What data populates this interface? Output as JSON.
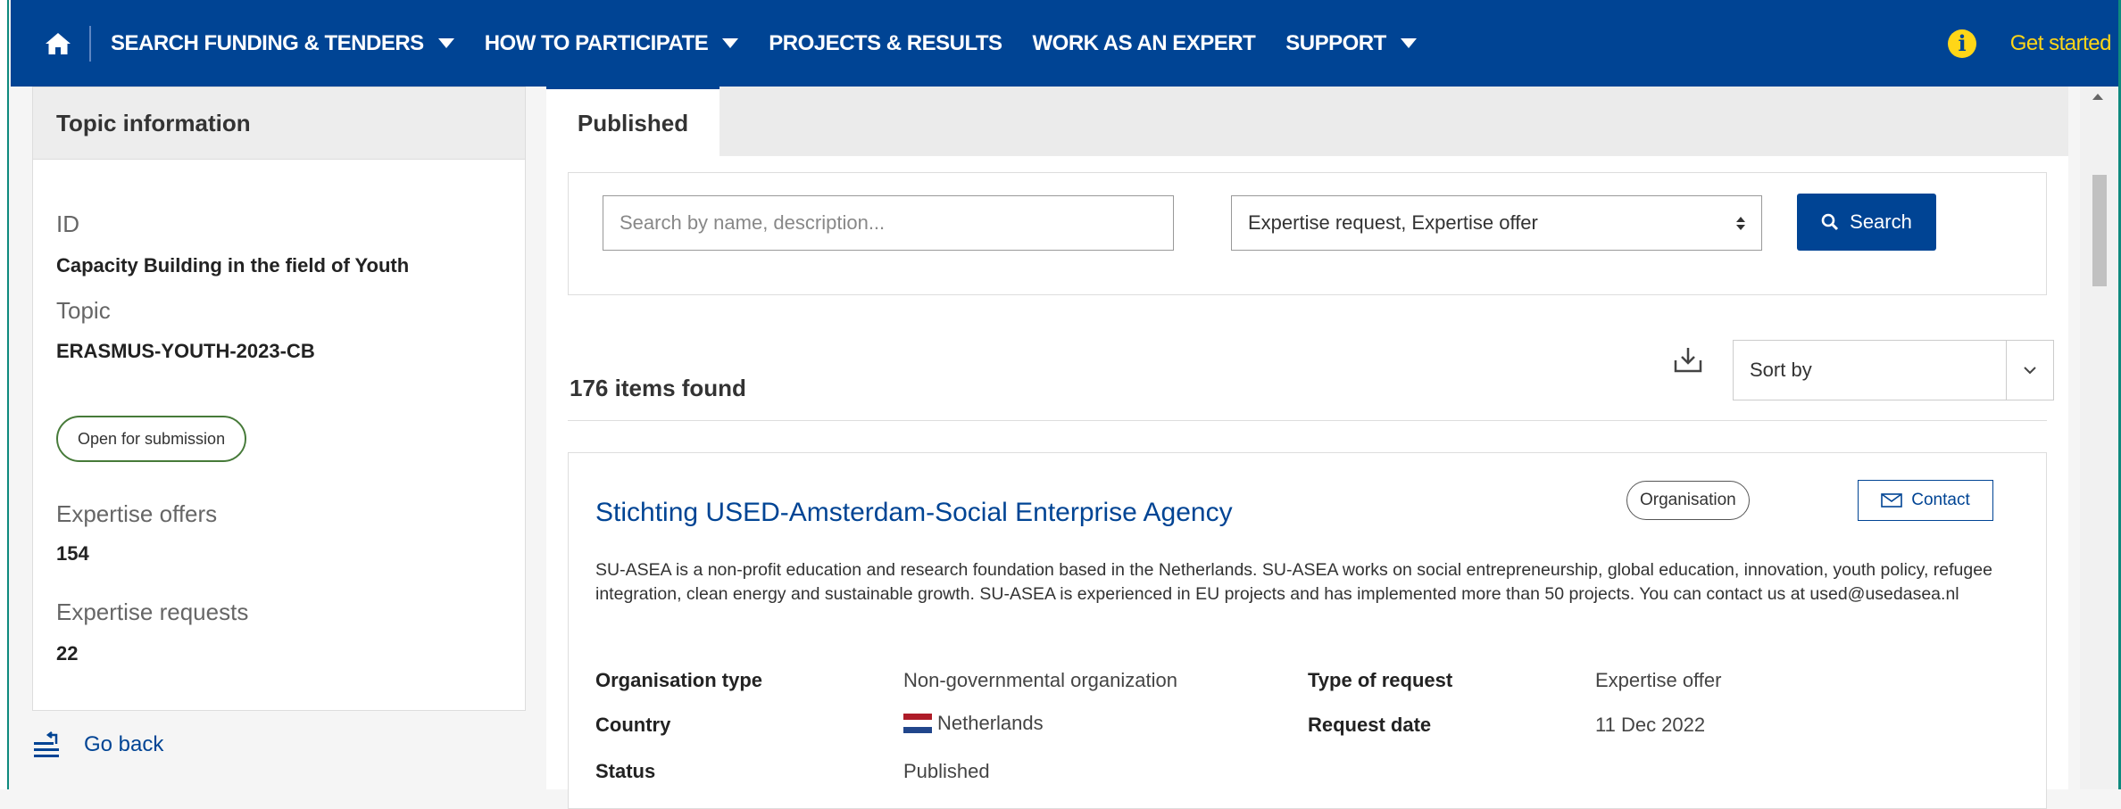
{
  "nav": {
    "items": [
      {
        "label": "SEARCH FUNDING & TENDERS",
        "dropdown": true
      },
      {
        "label": "HOW TO PARTICIPATE",
        "dropdown": true
      },
      {
        "label": "PROJECTS & RESULTS",
        "dropdown": false
      },
      {
        "label": "WORK AS AN EXPERT",
        "dropdown": false
      },
      {
        "label": "SUPPORT",
        "dropdown": true
      }
    ],
    "get_started": "Get started",
    "icons": {
      "home": "home-icon",
      "info": "info-icon"
    }
  },
  "sidebar": {
    "header": "Topic information",
    "id_label": "ID",
    "id_value": "Capacity Building in the field of Youth",
    "topic_label": "Topic",
    "topic_value": "ERASMUS-YOUTH-2023-CB",
    "status_pill": "Open for submission",
    "offers_label": "Expertise offers",
    "offers_value": "154",
    "requests_label": "Expertise requests",
    "requests_value": "22",
    "go_back": "Go back"
  },
  "tabs": [
    {
      "label": "Published",
      "active": true
    }
  ],
  "search": {
    "placeholder": "Search by name, description...",
    "filter_value": "Expertise request, Expertise offer",
    "button": "Search"
  },
  "results": {
    "count_text": "176 items found",
    "sort_label": "Sort by",
    "items": [
      {
        "title": "Stichting USED-Amsterdam-Social Enterprise Agency",
        "badge": "Organisation",
        "contact": "Contact",
        "description": "SU-ASEA is a non-profit education and research foundation based in the Netherlands. SU-ASEA works on social entrepreneurship, global education, innovation, youth policy, refugee integration, clean energy and sustainable growth. SU-ASEA is experienced in EU projects and has implemented more than 50 projects. You can contact us at used@usedasea.nl",
        "org_type_label": "Organisation type",
        "org_type_value": "Non-governmental organization",
        "country_label": "Country",
        "country_value": "Netherlands",
        "status_label": "Status",
        "status_value": "Published",
        "request_type_label": "Type of request",
        "request_type_value": "Expertise offer",
        "request_date_label": "Request date",
        "request_date_value": "11 Dec 2022"
      }
    ]
  },
  "colors": {
    "brand_blue": "#004494",
    "accent_yellow": "#ffd617",
    "pill_green": "#467a39",
    "edge_teal": "#0e8a7e"
  }
}
